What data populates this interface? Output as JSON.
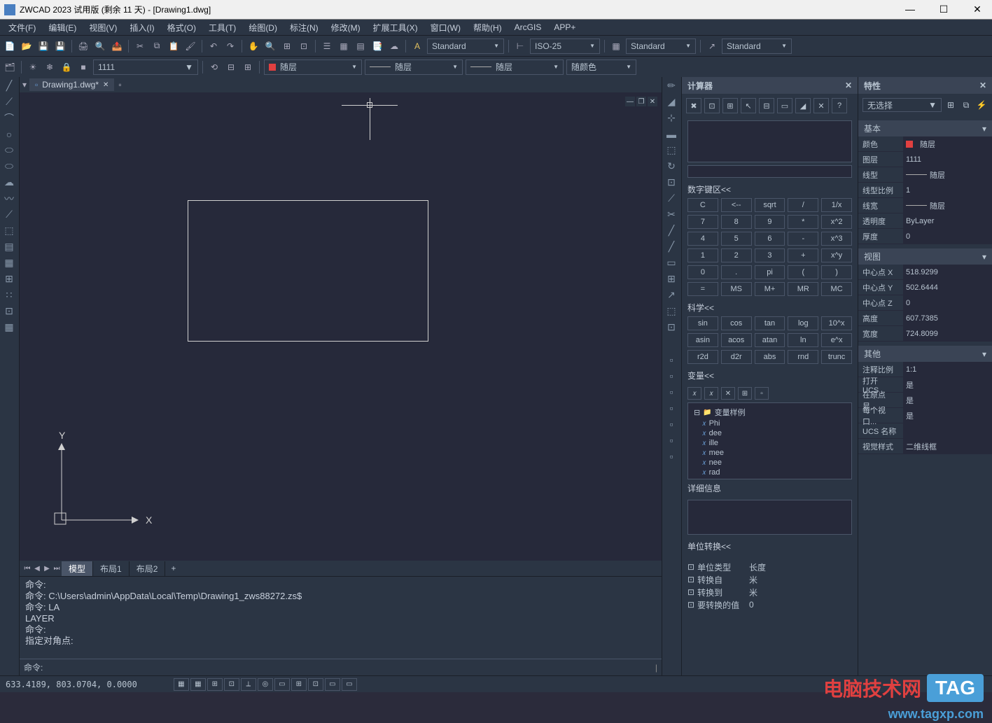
{
  "title": "ZWCAD 2023 试用版 (剩余 11 天) - [Drawing1.dwg]",
  "menu": [
    "文件(F)",
    "编辑(E)",
    "视图(V)",
    "插入(I)",
    "格式(O)",
    "工具(T)",
    "绘图(D)",
    "标注(N)",
    "修改(M)",
    "扩展工具(X)",
    "窗口(W)",
    "帮助(H)",
    "ArcGIS",
    "APP+"
  ],
  "layer": {
    "current": "1111",
    "color_dd": "随层",
    "linetype_dd": "随层",
    "lineweight_dd": "随层",
    "color2_dd": "随颜色"
  },
  "styles": {
    "text": "Standard",
    "dim": "ISO-25",
    "table": "Standard",
    "mleader": "Standard"
  },
  "doctab": {
    "name": "Drawing1.dwg*"
  },
  "modeltabs": {
    "model": "模型",
    "layout1": "布局1",
    "layout2": "布局2"
  },
  "cmd": {
    "lines": [
      "命令:",
      "命令: C:\\Users\\admin\\AppData\\Local\\Temp\\Drawing1_zws88272.zs$",
      "命令: LA",
      "LAYER",
      "命令:",
      "指定对角点:"
    ],
    "prompt": "命令: "
  },
  "status": {
    "coords": "633.4189, 803.0704, 0.0000"
  },
  "calc": {
    "title": "计算器",
    "numpad_hdr": "数字键区<<",
    "keys": [
      [
        "C",
        "<--",
        "sqrt",
        "/",
        "1/x"
      ],
      [
        "7",
        "8",
        "9",
        "*",
        "x^2"
      ],
      [
        "4",
        "5",
        "6",
        "-",
        "x^3"
      ],
      [
        "1",
        "2",
        "3",
        "+",
        "x^y"
      ],
      [
        "0",
        ".",
        "pi",
        "(",
        ")"
      ],
      [
        "=",
        "MS",
        "M+",
        "MR",
        "MC"
      ]
    ],
    "sci_hdr": "科学<<",
    "sci": [
      [
        "sin",
        "cos",
        "tan",
        "log",
        "10^x"
      ],
      [
        "asin",
        "acos",
        "atan",
        "ln",
        "e^x"
      ],
      [
        "r2d",
        "d2r",
        "abs",
        "rnd",
        "trunc"
      ]
    ],
    "var_hdr": "变量<<",
    "vars_root": "变量样例",
    "vars": [
      "Phi",
      "dee",
      "ille",
      "mee",
      "nee",
      "rad"
    ],
    "detail_hdr": "详细信息",
    "unit_hdr": "单位转换<<",
    "unit_rows": [
      [
        "单位类型",
        "长度"
      ],
      [
        "转换自",
        "米"
      ],
      [
        "转换到",
        "米"
      ],
      [
        "要转换的值",
        "0"
      ]
    ]
  },
  "props": {
    "title": "特性",
    "sel": "无选择",
    "sections": {
      "basic": {
        "hdr": "基本",
        "rows": [
          [
            "颜色",
            "随层"
          ],
          [
            "图层",
            "1111"
          ],
          [
            "线型",
            "随层"
          ],
          [
            "线型比例",
            "1"
          ],
          [
            "线宽",
            "随层"
          ],
          [
            "透明度",
            "ByLayer"
          ],
          [
            "厚度",
            "0"
          ]
        ]
      },
      "view": {
        "hdr": "视图",
        "rows": [
          [
            "中心点 X",
            "518.9299"
          ],
          [
            "中心点 Y",
            "502.6444"
          ],
          [
            "中心点 Z",
            "0"
          ],
          [
            "高度",
            "607.7385"
          ],
          [
            "宽度",
            "724.8099"
          ]
        ]
      },
      "other": {
        "hdr": "其他",
        "rows": [
          [
            "注释比例",
            "1:1"
          ],
          [
            "打开 UCS...",
            "是"
          ],
          [
            "在原点显...",
            "是"
          ],
          [
            "每个视口...",
            "是"
          ],
          [
            "UCS 名称",
            ""
          ],
          [
            "视觉样式",
            "二维线框"
          ]
        ]
      }
    }
  },
  "watermark": {
    "text1": "电脑技术网",
    "text2": "TAG",
    "url": "www.tagxp.com"
  }
}
